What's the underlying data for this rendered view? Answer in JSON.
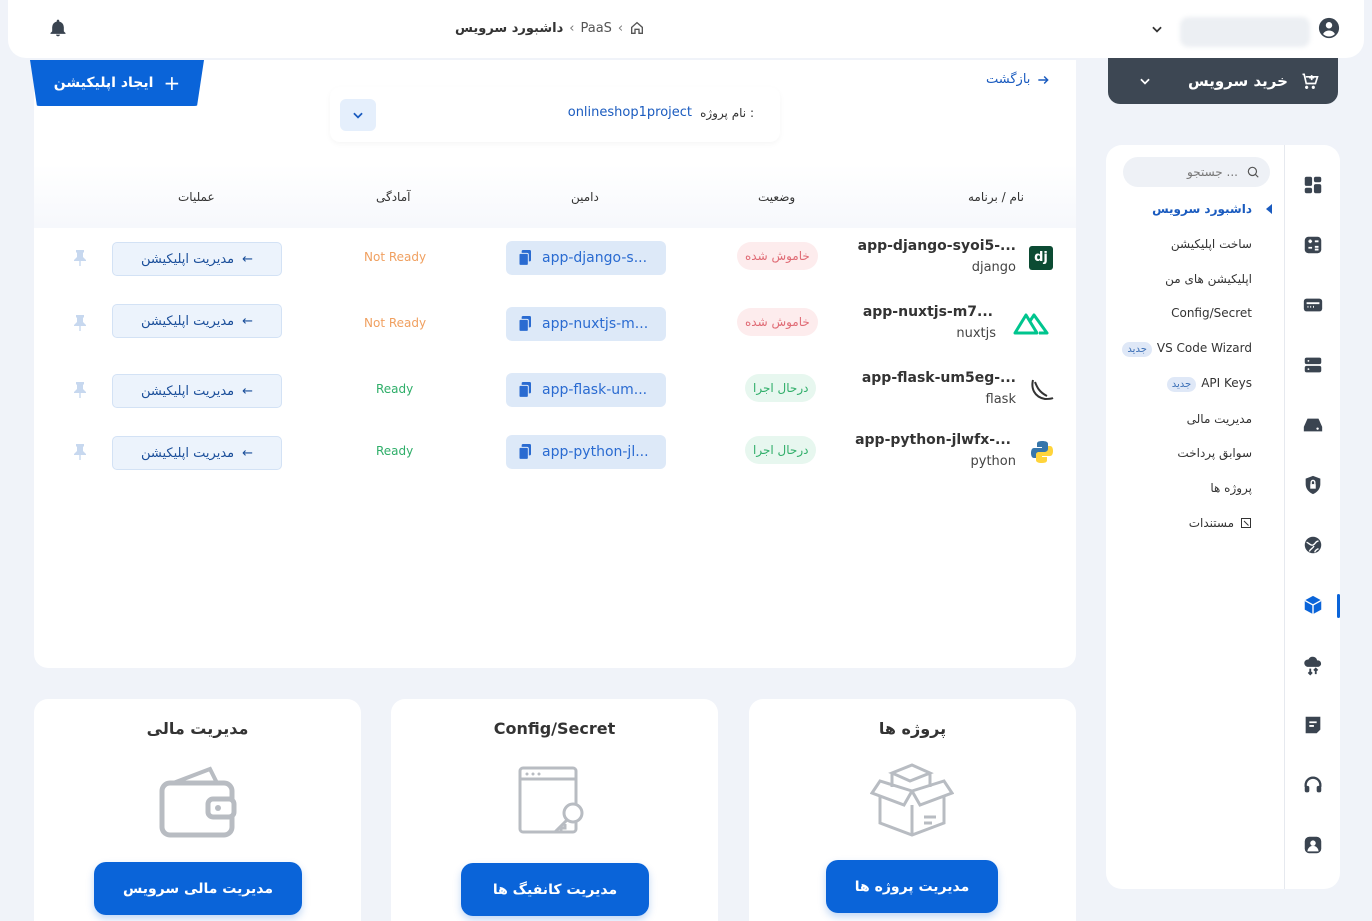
{
  "topbar": {
    "breadcrumb": {
      "root": "PaaS",
      "current": "داشبورد سرویس"
    }
  },
  "buy_service": {
    "label": "خرید سرویس"
  },
  "sidebar": {
    "search_placeholder": "جستجو ...",
    "items": [
      {
        "label": "داشبورد سرویس"
      },
      {
        "label": "ساخت اپلیکیشن"
      },
      {
        "label": "اپلیکیشن های من"
      },
      {
        "label": "Config/Secret"
      },
      {
        "label": "VS Code Wizard",
        "badge": "جدید"
      },
      {
        "label": "API Keys",
        "badge": "جدید"
      },
      {
        "label": "مدیریت مالی"
      },
      {
        "label": "سوابق پرداخت"
      },
      {
        "label": "پروژه ها"
      },
      {
        "label": "مستندات"
      }
    ]
  },
  "main": {
    "create_button": "ایجاد اپلیکیشن",
    "back_link": "بازگشت",
    "project_label": "نام پروژه :",
    "project_value": "onlineshop1project",
    "columns": {
      "name": "نام / برنامه",
      "status": "وضعیت",
      "domain": "دامین",
      "readiness": "آمادگی",
      "actions": "عملیات"
    },
    "rows": [
      {
        "name": "app-django-syoi5-...",
        "framework": "django",
        "status": "خاموش شده",
        "domain": "app-django-s...",
        "readiness": "Not Ready",
        "action": "مدیریت اپلیکیشن"
      },
      {
        "name": "app-nuxtjs-m7...",
        "framework": "nuxtjs",
        "status": "خاموش شده",
        "domain": "app-nuxtjs-m...",
        "readiness": "Not Ready",
        "action": "مدیریت اپلیکیشن"
      },
      {
        "name": "app-flask-um5eg-...",
        "framework": "flask",
        "status": "درحال اجرا",
        "domain": "app-flask-um...",
        "readiness": "Ready",
        "action": "مدیریت اپلیکیشن"
      },
      {
        "name": "app-python-jlwfx-...",
        "framework": "python",
        "status": "درحال اجرا",
        "domain": "app-python-jl...",
        "readiness": "Ready",
        "action": "مدیریت اپلیکیشن"
      }
    ]
  },
  "cards": [
    {
      "title": "مدیریت مالی",
      "button": "مدیریت مالی سرویس"
    },
    {
      "title": "Config/Secret",
      "button": "مدیریت کانفیگ ها"
    },
    {
      "title": "پروژه ها",
      "button": "مدیریت پروژه ها"
    }
  ],
  "colors": {
    "primary": "#0a64d9",
    "dark": "#3d4753",
    "off": "#e06b75",
    "on": "#2fae69",
    "notready": "#f0a060"
  }
}
